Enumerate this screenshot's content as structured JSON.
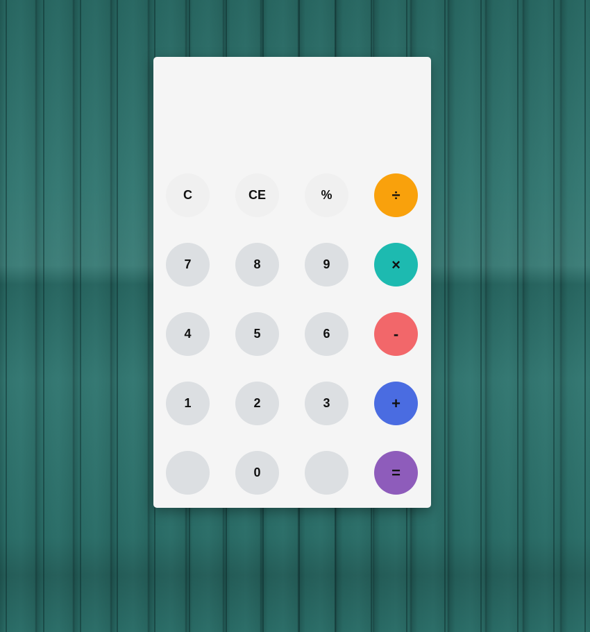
{
  "display": {
    "value": ""
  },
  "keys": [
    {
      "id": "c",
      "label": "C",
      "type": "func",
      "row": 0,
      "col": 0
    },
    {
      "id": "ce",
      "label": "CE",
      "type": "func",
      "row": 0,
      "col": 1
    },
    {
      "id": "percent",
      "label": "%",
      "type": "func",
      "row": 0,
      "col": 2
    },
    {
      "id": "divide",
      "label": "÷",
      "type": "op",
      "color": "#f9a10c",
      "row": 0,
      "col": 3
    },
    {
      "id": "7",
      "label": "7",
      "type": "num",
      "row": 1,
      "col": 0
    },
    {
      "id": "8",
      "label": "8",
      "type": "num",
      "row": 1,
      "col": 1
    },
    {
      "id": "9",
      "label": "9",
      "type": "num",
      "row": 1,
      "col": 2
    },
    {
      "id": "multiply",
      "label": "×",
      "type": "op",
      "color": "#1dbab0",
      "row": 1,
      "col": 3
    },
    {
      "id": "4",
      "label": "4",
      "type": "num",
      "row": 2,
      "col": 0
    },
    {
      "id": "5",
      "label": "5",
      "type": "num",
      "row": 2,
      "col": 1
    },
    {
      "id": "6",
      "label": "6",
      "type": "num",
      "row": 2,
      "col": 2
    },
    {
      "id": "minus",
      "label": "-",
      "type": "op",
      "color": "#f2676a",
      "row": 2,
      "col": 3
    },
    {
      "id": "1",
      "label": "1",
      "type": "num",
      "row": 3,
      "col": 0
    },
    {
      "id": "2",
      "label": "2",
      "type": "num",
      "row": 3,
      "col": 1
    },
    {
      "id": "3",
      "label": "3",
      "type": "num",
      "row": 3,
      "col": 2
    },
    {
      "id": "plus",
      "label": "+",
      "type": "op",
      "color": "#4a6ce1",
      "row": 3,
      "col": 3
    },
    {
      "id": "blank-left",
      "label": "",
      "type": "num",
      "row": 4,
      "col": 0
    },
    {
      "id": "0",
      "label": "0",
      "type": "num",
      "row": 4,
      "col": 1
    },
    {
      "id": "blank-right",
      "label": "",
      "type": "num",
      "row": 4,
      "col": 2
    },
    {
      "id": "equals",
      "label": "=",
      "type": "op",
      "color": "#8e5cbb",
      "row": 4,
      "col": 3
    }
  ],
  "colors": {
    "background": "#2a6e68",
    "panel": "#f5f5f5",
    "number_key": "#dcdfe2",
    "function_key": "#f0f0f0"
  }
}
